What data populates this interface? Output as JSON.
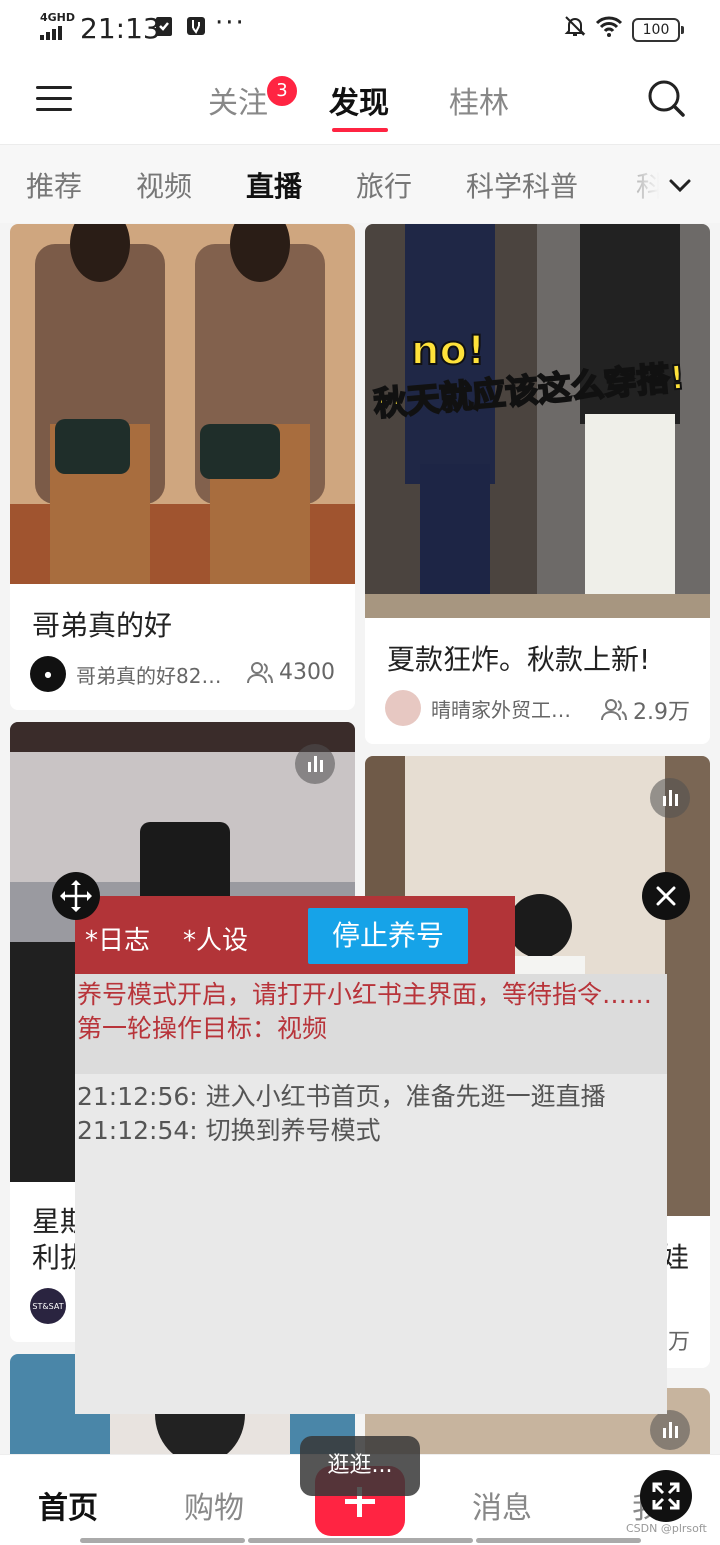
{
  "status_bar": {
    "network": "4GHD",
    "time": "21:13",
    "more": "···",
    "battery": "100"
  },
  "top_nav": {
    "tabs": [
      {
        "label": "关注",
        "badge": "3"
      },
      {
        "label": "发现"
      },
      {
        "label": "桂林"
      }
    ],
    "active_tab": "发现",
    "accent_color": "#ff2442"
  },
  "categories": [
    "推荐",
    "视频",
    "直播",
    "旅行",
    "科学科普",
    "科"
  ],
  "active_category": "直播",
  "feed": [
    {
      "title": "哥弟真的好",
      "author": "哥弟真的好82…",
      "viewers": "4300",
      "image_caption": ""
    },
    {
      "title": "夏款狂炸。秋款上新!",
      "author": "晴晴家外贸工…",
      "viewers": "2.9万",
      "image_caption_1": "no!",
      "image_caption_2": "秋天就应该这么穿搭!"
    },
    {
      "title_part_1": "星期",
      "title_part_2": "利拔",
      "avatar_text": "ST&SAT"
    },
    {
      "title_fragment": "娃",
      "viewers_fragment": "万"
    }
  ],
  "overlay": {
    "tabs": [
      "*日志",
      "*人设"
    ],
    "stop_button": "停止养号",
    "status_message": "养号模式开启，请打开小红书主界面，等待指令……第一轮操作目标：视频",
    "log": [
      "21:12:56: 进入小红书首页，准备先逛一逛直播",
      "21:12:54: 切换到养号模式"
    ]
  },
  "bottom_nav": {
    "items": [
      "首页",
      "购物",
      "消息",
      "我"
    ],
    "active": "首页"
  },
  "toast": "逛逛...",
  "watermark": "CSDN @plrsoft"
}
